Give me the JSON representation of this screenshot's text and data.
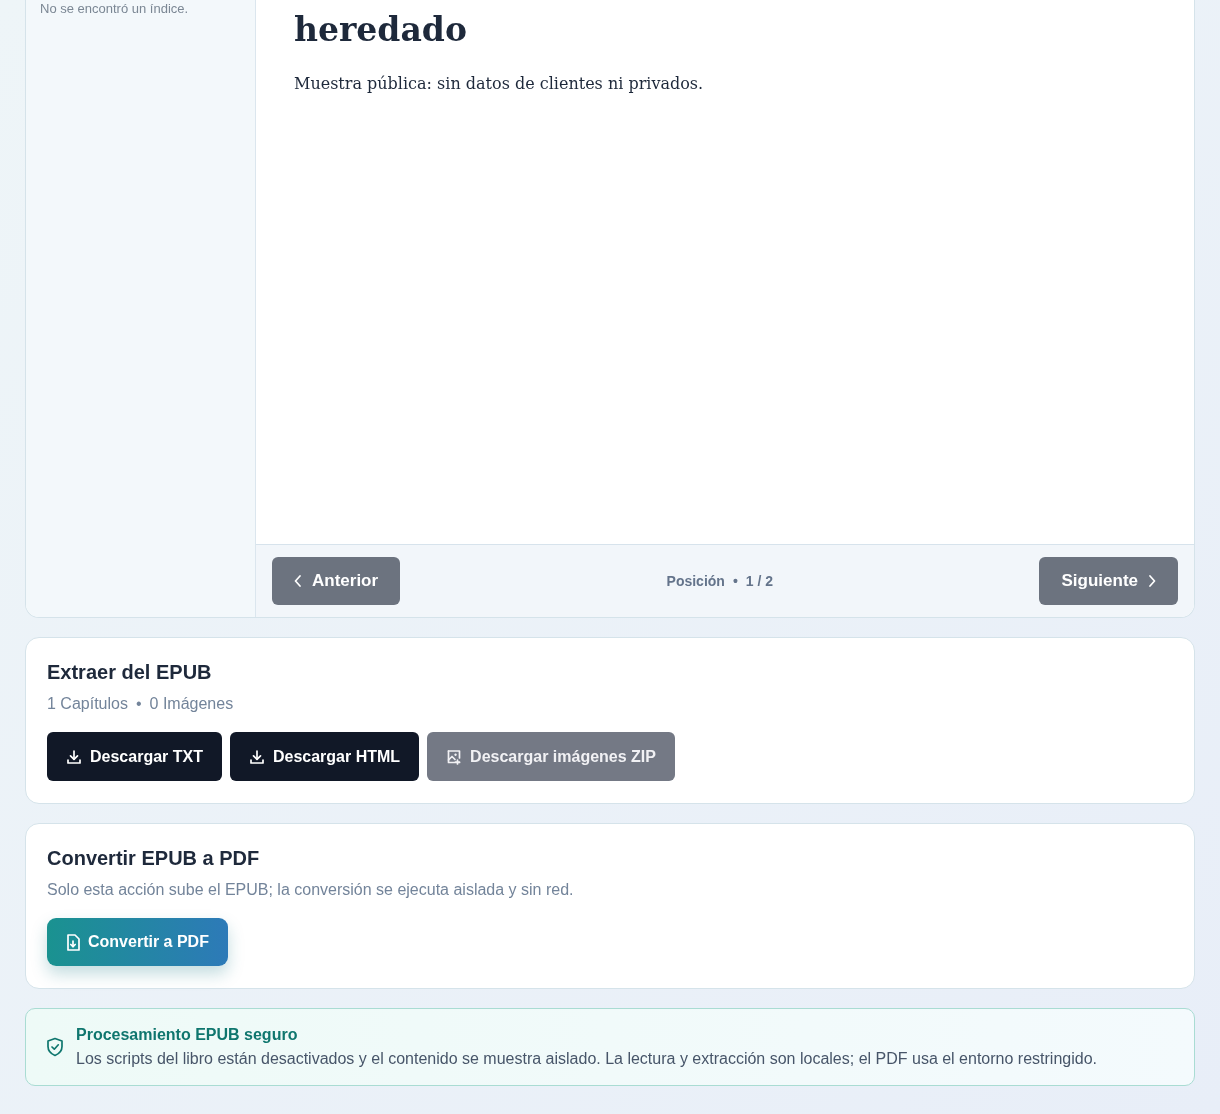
{
  "reader": {
    "toc_empty": "No se encontró un índice.",
    "chapter_title": "heredado",
    "chapter_text": "Muestra pública: sin datos de clientes ni privados.",
    "prev_button": {
      "label": "Anterior"
    },
    "position_label": "Posición",
    "position_separator": "•",
    "position_value": "1 / 2",
    "next_button": {
      "label": "Siguiente"
    }
  },
  "extract": {
    "title": "Extraer del EPUB",
    "chapters": "1 Capítulos",
    "separator": "•",
    "images": "0 Imágenes",
    "buttons": [
      {
        "label": "Descargar TXT",
        "kind": "download",
        "disabled": false
      },
      {
        "label": "Descargar HTML",
        "kind": "download",
        "disabled": false
      },
      {
        "label": "Descargar imágenes ZIP",
        "kind": "images",
        "disabled": true
      }
    ]
  },
  "convert": {
    "title": "Convertir EPUB a PDF",
    "description": "Solo esta acción sube el EPUB; la conversión se ejecuta aislada y sin red.",
    "button": {
      "label": "Convertir a PDF"
    }
  },
  "notice": {
    "title": "Procesamiento EPUB seguro",
    "text": "Los scripts del libro están desactivados y el contenido se muestra aislado. La lectura y extracción son locales; el PDF usa el entorno restringido."
  }
}
